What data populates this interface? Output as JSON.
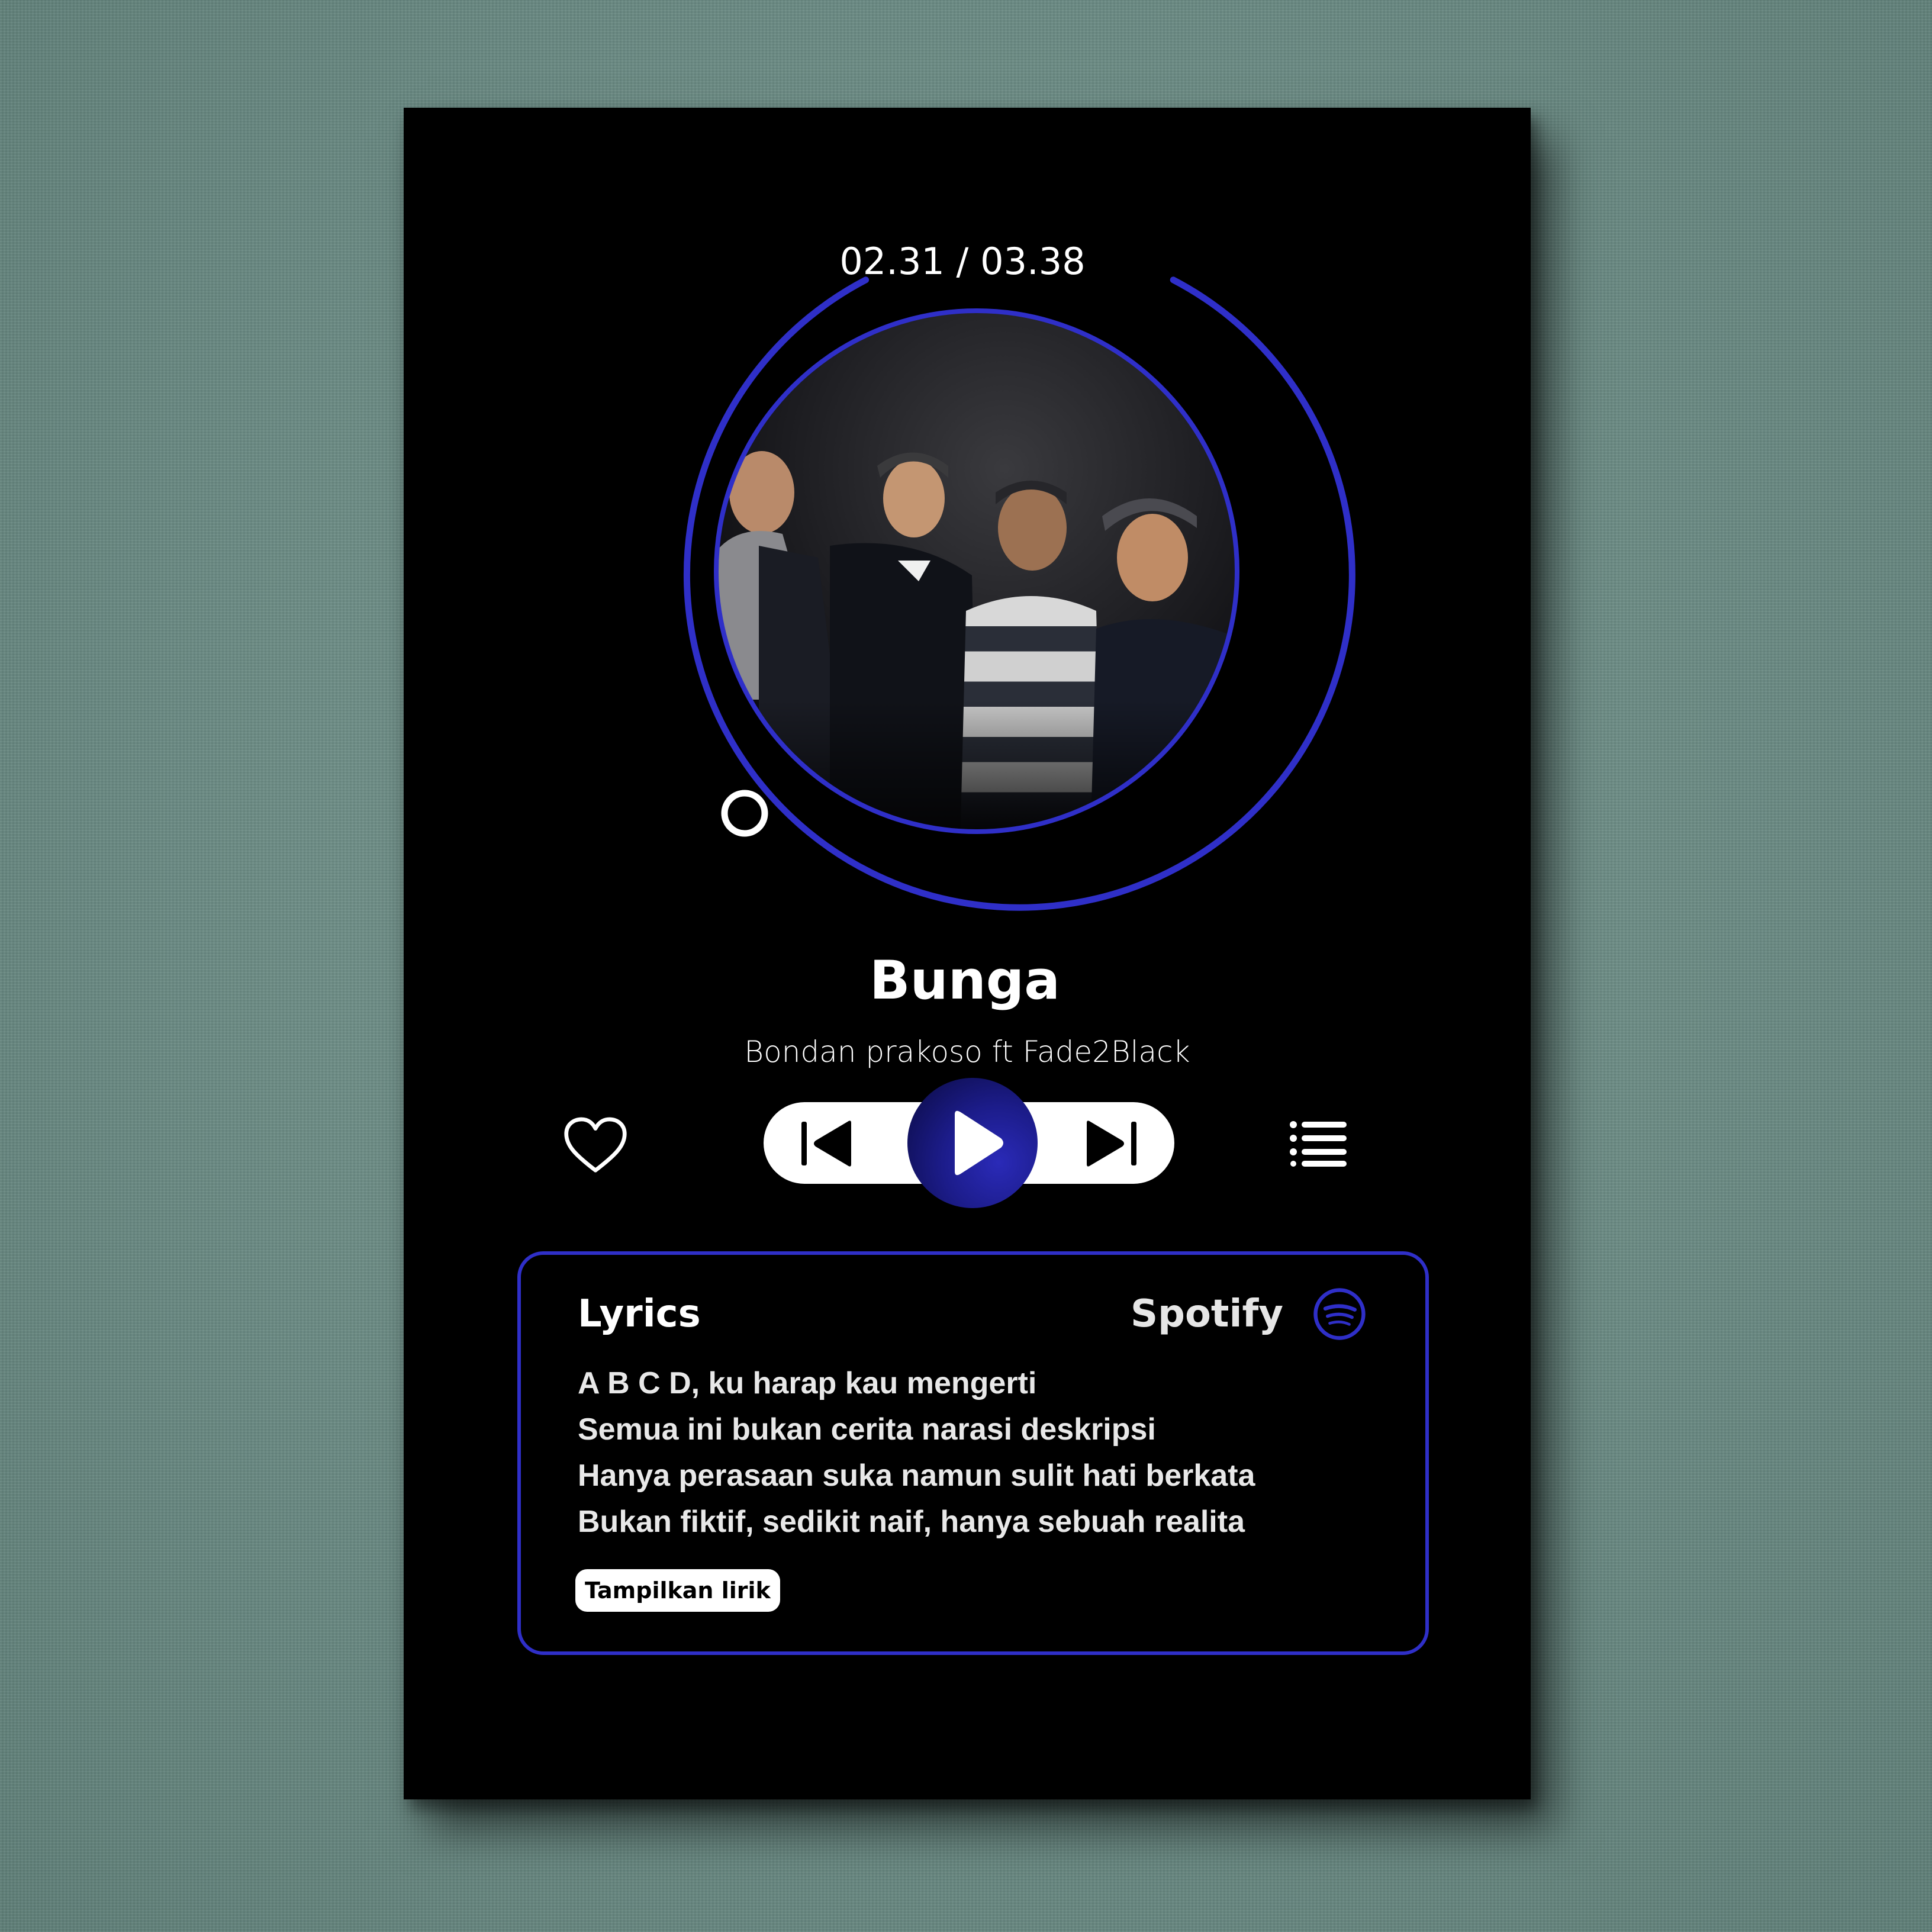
{
  "player": {
    "time_display": "02.31 / 03.38",
    "progress_fraction": 0.7,
    "track_title": "Bunga",
    "artist": "Bondan prakoso ft Fade2Black"
  },
  "colors": {
    "accent": "#2f2fc8",
    "play_button": "#1c1c8a",
    "background": "#000000",
    "wall": "#6f9089"
  },
  "controls": {
    "like_icon": "heart-icon",
    "previous_icon": "skip-previous-icon",
    "play_icon": "play-icon",
    "next_icon": "skip-next-icon",
    "queue_icon": "list-icon"
  },
  "lyrics_panel": {
    "heading": "Lyrics",
    "source": "Spotify",
    "source_icon": "spotify-icon",
    "lines": [
      "A B C D, ku harap kau mengerti",
      "Semua ini bukan cerita narasi deskripsi",
      "Hanya perasaan suka namun sulit hati berkata",
      "Bukan fiktif, sedikit naif, hanya sebuah realita"
    ],
    "show_button": "Tampilkan lirik"
  }
}
